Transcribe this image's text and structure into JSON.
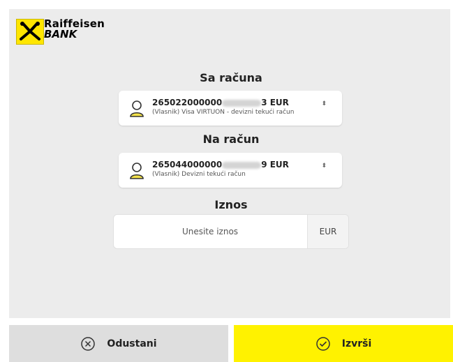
{
  "brand": {
    "line1": "Raiffeisen",
    "line2": "BANK",
    "color": "#ffe600"
  },
  "from_account": {
    "title": "Sa računa",
    "number_prefix": "265022000000",
    "number_suffix": "3 EUR",
    "description": "(Vlasnik) Visa VIRTUON - devizni tekući račun",
    "icon": "user-icon",
    "arrows": "⬍"
  },
  "to_account": {
    "title": "Na račun",
    "number_prefix": "265044000000",
    "number_suffix": "9 EUR",
    "description": "(Vlasnik) Devizni tekući račun",
    "icon": "user-icon",
    "arrows": "⬍"
  },
  "amount": {
    "title": "Iznos",
    "placeholder": "Unesite iznos",
    "currency": "EUR"
  },
  "actions": {
    "cancel_label": "Odustani",
    "confirm_label": "Izvrši",
    "confirm_color": "#fff200"
  }
}
